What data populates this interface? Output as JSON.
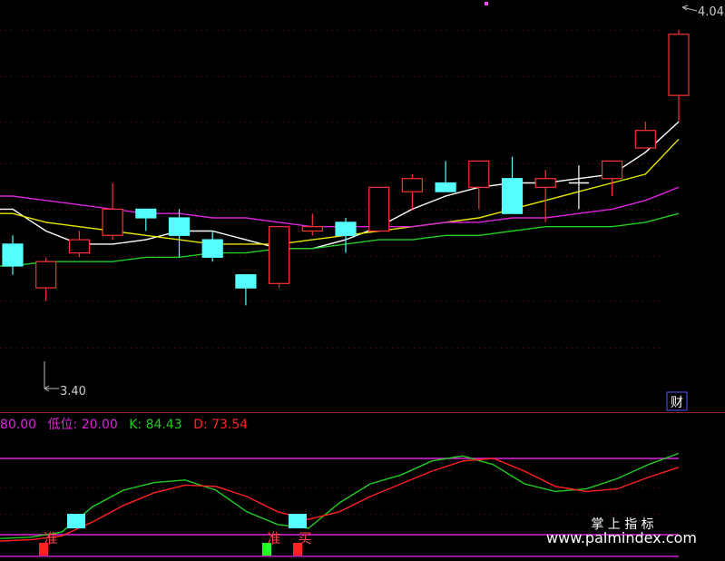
{
  "chart_data": [
    {
      "type": "candlestick",
      "price_labels": {
        "high": "4.04",
        "low": "3.40"
      },
      "corner_badge": "财",
      "ylim": [
        3.17,
        4.1
      ],
      "candles": [
        {
          "o": 3.55,
          "c": 3.5,
          "h": 3.57,
          "l": 3.48
        },
        {
          "o": 3.45,
          "c": 3.51,
          "h": 3.52,
          "l": 3.42
        },
        {
          "o": 3.53,
          "c": 3.56,
          "h": 3.58,
          "l": 3.52
        },
        {
          "o": 3.57,
          "c": 3.63,
          "h": 3.69,
          "l": 3.56
        },
        {
          "o": 3.63,
          "c": 3.61,
          "h": 3.63,
          "l": 3.58
        },
        {
          "o": 3.61,
          "c": 3.57,
          "h": 3.63,
          "l": 3.52
        },
        {
          "o": 3.56,
          "c": 3.52,
          "h": 3.58,
          "l": 3.51
        },
        {
          "o": 3.48,
          "c": 3.45,
          "h": 3.48,
          "l": 3.41
        },
        {
          "o": 3.46,
          "c": 3.59,
          "h": 3.59,
          "l": 3.45
        },
        {
          "o": 3.58,
          "c": 3.59,
          "h": 3.62,
          "l": 3.57
        },
        {
          "o": 3.6,
          "c": 3.57,
          "h": 3.61,
          "l": 3.53
        },
        {
          "o": 3.58,
          "c": 3.68,
          "h": 3.68,
          "l": 3.58
        },
        {
          "o": 3.67,
          "c": 3.7,
          "h": 3.71,
          "l": 3.63
        },
        {
          "o": 3.69,
          "c": 3.67,
          "h": 3.74,
          "l": 3.67
        },
        {
          "o": 3.68,
          "c": 3.74,
          "h": 3.74,
          "l": 3.63
        },
        {
          "o": 3.7,
          "c": 3.62,
          "h": 3.75,
          "l": 3.62
        },
        {
          "o": 3.68,
          "c": 3.7,
          "h": 3.72,
          "l": 3.6
        },
        {
          "o": 3.69,
          "c": 3.69,
          "h": 3.73,
          "l": 3.63
        },
        {
          "o": 3.7,
          "c": 3.74,
          "h": 3.74,
          "l": 3.66
        },
        {
          "o": 3.77,
          "c": 3.81,
          "h": 3.83,
          "l": 3.77
        },
        {
          "o": 3.89,
          "c": 4.03,
          "h": 4.04,
          "l": 3.83
        }
      ],
      "ma": [
        {
          "color": "#ffffff",
          "values": [
            3.63,
            3.58,
            3.55,
            3.55,
            3.56,
            3.58,
            3.58,
            3.56,
            3.54,
            3.54,
            3.56,
            3.59,
            3.63,
            3.66,
            3.68,
            3.69,
            3.69,
            3.7,
            3.71,
            3.76,
            3.83
          ]
        },
        {
          "color": "#e6e600",
          "values": [
            3.62,
            3.6,
            3.59,
            3.58,
            3.57,
            3.56,
            3.55,
            3.55,
            3.55,
            3.56,
            3.57,
            3.58,
            3.59,
            3.6,
            3.61,
            3.63,
            3.65,
            3.67,
            3.69,
            3.71,
            3.79
          ]
        },
        {
          "color": "#dd22dd",
          "values": [
            3.66,
            3.65,
            3.64,
            3.63,
            3.62,
            3.62,
            3.61,
            3.61,
            3.6,
            3.59,
            3.59,
            3.59,
            3.59,
            3.6,
            3.6,
            3.61,
            3.61,
            3.62,
            3.63,
            3.65,
            3.68
          ]
        },
        {
          "color": "#22cc22",
          "values": [
            3.5,
            3.51,
            3.51,
            3.51,
            3.52,
            3.52,
            3.53,
            3.53,
            3.54,
            3.54,
            3.55,
            3.56,
            3.56,
            3.57,
            3.57,
            3.58,
            3.59,
            3.59,
            3.59,
            3.6,
            3.62
          ]
        }
      ]
    },
    {
      "type": "line",
      "legend": [
        {
          "text": "80.00",
          "color": "#dd22dd"
        },
        {
          "text": "低位: 20.00",
          "color": "#dd22dd"
        },
        {
          "text": "K: 84.43",
          "color": "#22cc22"
        },
        {
          "text": "D: 73.54",
          "color": "#ff2222"
        }
      ],
      "ylim": [
        0,
        100
      ],
      "ref_lines": [
        80,
        20,
        3
      ],
      "series": [
        {
          "color": "#22cc22",
          "values": [
            17,
            18,
            22,
            42,
            55,
            61,
            63,
            55,
            38,
            28,
            25,
            45,
            60,
            67,
            78,
            82,
            75,
            60,
            54,
            56,
            64,
            75,
            84
          ]
        },
        {
          "color": "#ff2222",
          "values": [
            15,
            16,
            19,
            30,
            43,
            53,
            59,
            58,
            50,
            38,
            32,
            38,
            50,
            60,
            70,
            78,
            80,
            70,
            58,
            54,
            56,
            65,
            73
          ]
        }
      ],
      "signals": [
        {
          "x": 48,
          "label": "准",
          "marker_color": "#ff2222",
          "box_color": ""
        },
        {
          "x": 84,
          "label": "",
          "marker_color": "",
          "box_color": "#55ffff"
        },
        {
          "x": 294,
          "label": "准",
          "marker_color": "#22ff22",
          "box_color": ""
        },
        {
          "x": 328,
          "label": "买",
          "marker_color": "#ff2222",
          "box_color": "#55ffff"
        }
      ]
    }
  ],
  "watermark": {
    "name": "掌 上 指 标",
    "url": "www.palmindex.com"
  }
}
